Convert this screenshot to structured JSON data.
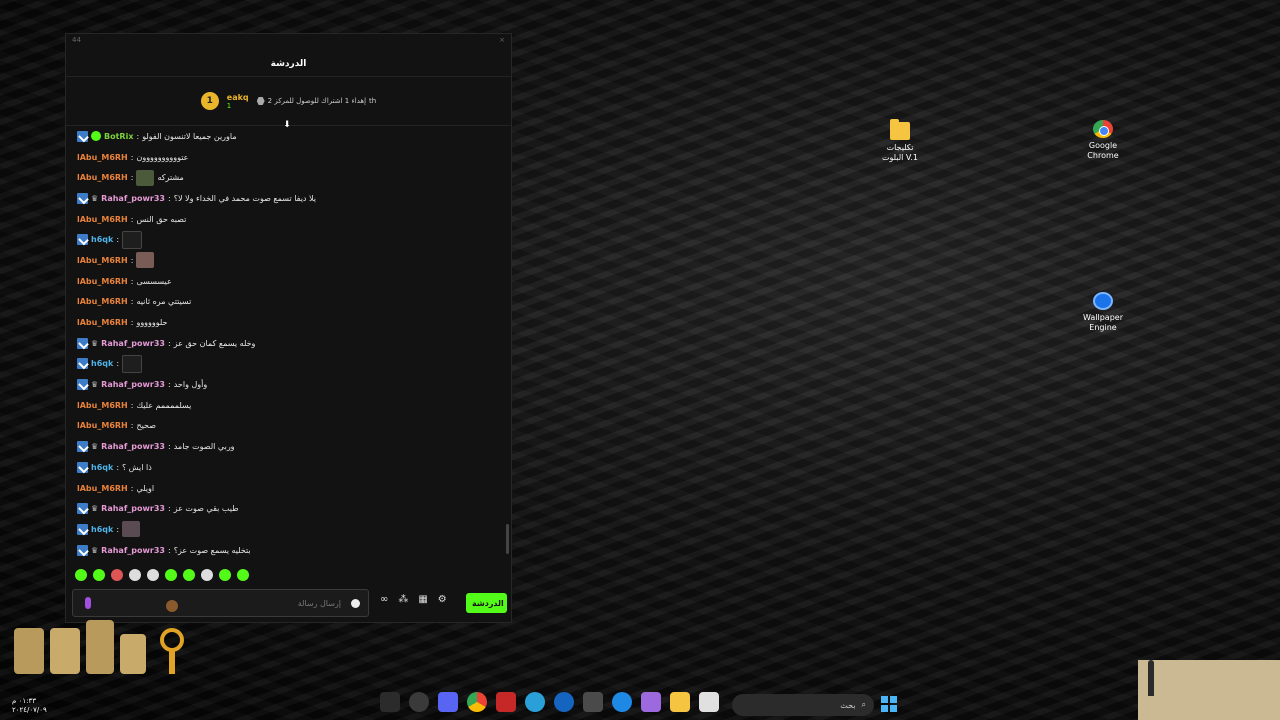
{
  "desktop": {
    "icons": [
      {
        "label_line1": "تكليجات",
        "label_line2": "البلوت V.1"
      },
      {
        "label_line1": "Google",
        "label_line2": "Chrome"
      },
      {
        "label_line1": "Wallpaper",
        "label_line2": "Engine"
      }
    ]
  },
  "chat": {
    "window_id": "44",
    "close": "×",
    "title": "الدردشة",
    "goal": {
      "rank": "1",
      "username": "eakq",
      "count": "1",
      "text": "إهداء 1 اشتراك للوصول للمركز 2",
      "suffix": "th"
    },
    "messages": [
      {
        "user": "BotRix",
        "text": "ماورين جميعا لاتنسون الفولو",
        "color": "green"
      },
      {
        "user": "lAbu_M6RH",
        "text": "عتوووووووووون",
        "color": "orange"
      },
      {
        "user": "lAbu_M6RH",
        "text": "مشتركه",
        "color": "orange"
      },
      {
        "user": "Rahaf_powr33",
        "text": "يلا ديفا تسمع صوت محمد في الخداء ولا لا؟",
        "color": "pink"
      },
      {
        "user": "lAbu_M6RH",
        "text": "تصبه حق النس",
        "color": "orange"
      },
      {
        "user": "h6qk",
        "text": "",
        "color": "blue"
      },
      {
        "user": "lAbu_M6RH",
        "text": "",
        "color": "orange"
      },
      {
        "user": "lAbu_M6RH",
        "text": "عيسسسى",
        "color": "orange"
      },
      {
        "user": "lAbu_M6RH",
        "text": "تسيتتي مره ثانيه",
        "color": "orange"
      },
      {
        "user": "lAbu_M6RH",
        "text": "حلوووووو",
        "color": "orange"
      },
      {
        "user": "Rahaf_powr33",
        "text": "وخله يسمع كمان حق عز",
        "color": "pink"
      },
      {
        "user": "h6qk",
        "text": "",
        "color": "blue"
      },
      {
        "user": "Rahaf_powr33",
        "text": "وأول واحد",
        "color": "pink"
      },
      {
        "user": "lAbu_M6RH",
        "text": "يسلممممم عليك",
        "color": "orange"
      },
      {
        "user": "lAbu_M6RH",
        "text": "صحيح",
        "color": "orange"
      },
      {
        "user": "Rahaf_powr33",
        "text": "وربي الصوت جامد",
        "color": "pink"
      },
      {
        "user": "h6qk",
        "text": "ذا ايش ؟",
        "color": "blue"
      },
      {
        "user": "lAbu_M6RH",
        "text": "اويلي",
        "color": "orange"
      },
      {
        "user": "Rahaf_powr33",
        "text": "طيب بقي صوت عز",
        "color": "pink"
      },
      {
        "user": "h6qk",
        "text": "",
        "color": "blue"
      },
      {
        "user": "Rahaf_powr33",
        "text": "بتخليه يسمع صوت عز؟",
        "color": "pink"
      }
    ],
    "input_placeholder": "إرسال رسالة",
    "send_label": "الدردشة",
    "scroll_hint": "⬇"
  },
  "taskbar": {
    "search_placeholder": "بحث",
    "clock_time": "٠١:٣٣ م",
    "clock_date": "٢٠٢٤/٠٧/٠٩"
  },
  "colors": {
    "kick_green": "#53fc18",
    "orange_user": "#e8823b",
    "blue_user": "#4fb2e8",
    "pink_user": "#e59ad6"
  }
}
